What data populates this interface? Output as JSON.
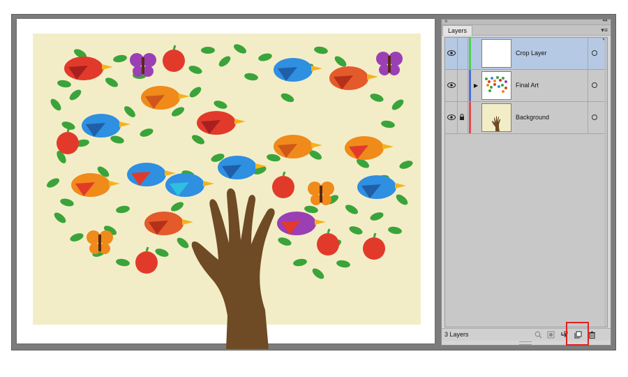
{
  "panel": {
    "tab_label": "Layers",
    "close_glyph": "×",
    "collapse_glyph": "◂◂",
    "menu_glyph": "▾≡",
    "layer_count": "3 Layers",
    "layers": [
      {
        "name": "Crop Layer",
        "color": "#4bd34b",
        "visible": true,
        "locked": false,
        "expandable": false,
        "selected": true
      },
      {
        "name": "Final Art",
        "color": "#4a6de0",
        "visible": true,
        "locked": false,
        "expandable": true,
        "selected": false
      },
      {
        "name": "Background",
        "color": "#e24a4a",
        "visible": true,
        "locked": true,
        "expandable": false,
        "selected": false
      }
    ],
    "bottom_icons": [
      "locate-object-icon",
      "make-clipping-mask-icon",
      "create-sublayer-icon",
      "create-new-layer-icon",
      "delete-layer-icon"
    ]
  },
  "colors": {
    "background_fill": "#f3edc7",
    "hand": "#6e4a25",
    "highlight": "#e0211e",
    "leaf": "#3aa43a",
    "apple": "#e23a2a"
  },
  "expand_glyph": "▶"
}
